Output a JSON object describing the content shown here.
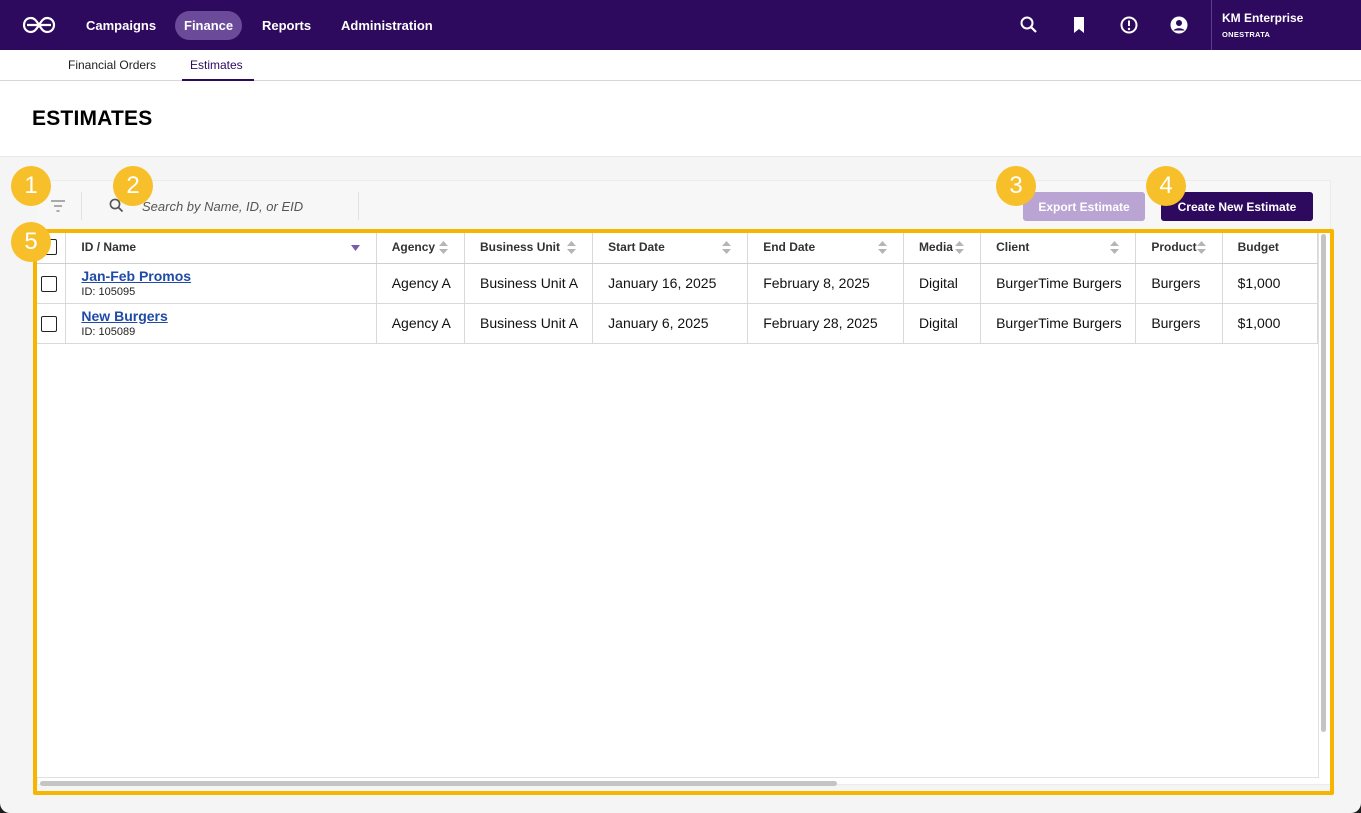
{
  "nav": {
    "items": [
      "Campaigns",
      "Finance",
      "Reports",
      "Administration"
    ],
    "active": "Finance",
    "account_name": "KM Enterprise",
    "account_org": "ONESTRATA"
  },
  "subtabs": [
    "Financial Orders",
    "Estimates"
  ],
  "page": {
    "title": "ESTIMATES"
  },
  "toolbar": {
    "search_placeholder": "Search by Name, ID, or EID",
    "export_label": "Export Estimate",
    "create_label": "Create New Estimate"
  },
  "table": {
    "columns": [
      "ID / Name",
      "Agency",
      "Business Unit",
      "Start Date",
      "End Date",
      "Media",
      "Client",
      "Product",
      "Budget"
    ],
    "rows": [
      {
        "name": "Jan-Feb Promos",
        "id": "ID: 105095",
        "agency": "Agency A",
        "business_unit": "Business Unit A",
        "start": "January 16, 2025",
        "end": "February 8, 2025",
        "media": "Digital",
        "client": "BurgerTime Burgers",
        "product": "Burgers",
        "budget": "$1,000"
      },
      {
        "name": "New Burgers",
        "id": "ID: 105089",
        "agency": "Agency A",
        "business_unit": "Business Unit A",
        "start": "January 6, 2025",
        "end": "February 28, 2025",
        "media": "Digital",
        "client": "BurgerTime Burgers",
        "product": "Burgers",
        "budget": "$1,000"
      }
    ]
  },
  "markers": [
    "1",
    "2",
    "3",
    "4",
    "5"
  ],
  "colors": {
    "brand": "#2d0a5e",
    "highlight": "#f7b500",
    "link": "#1f4aa8"
  }
}
